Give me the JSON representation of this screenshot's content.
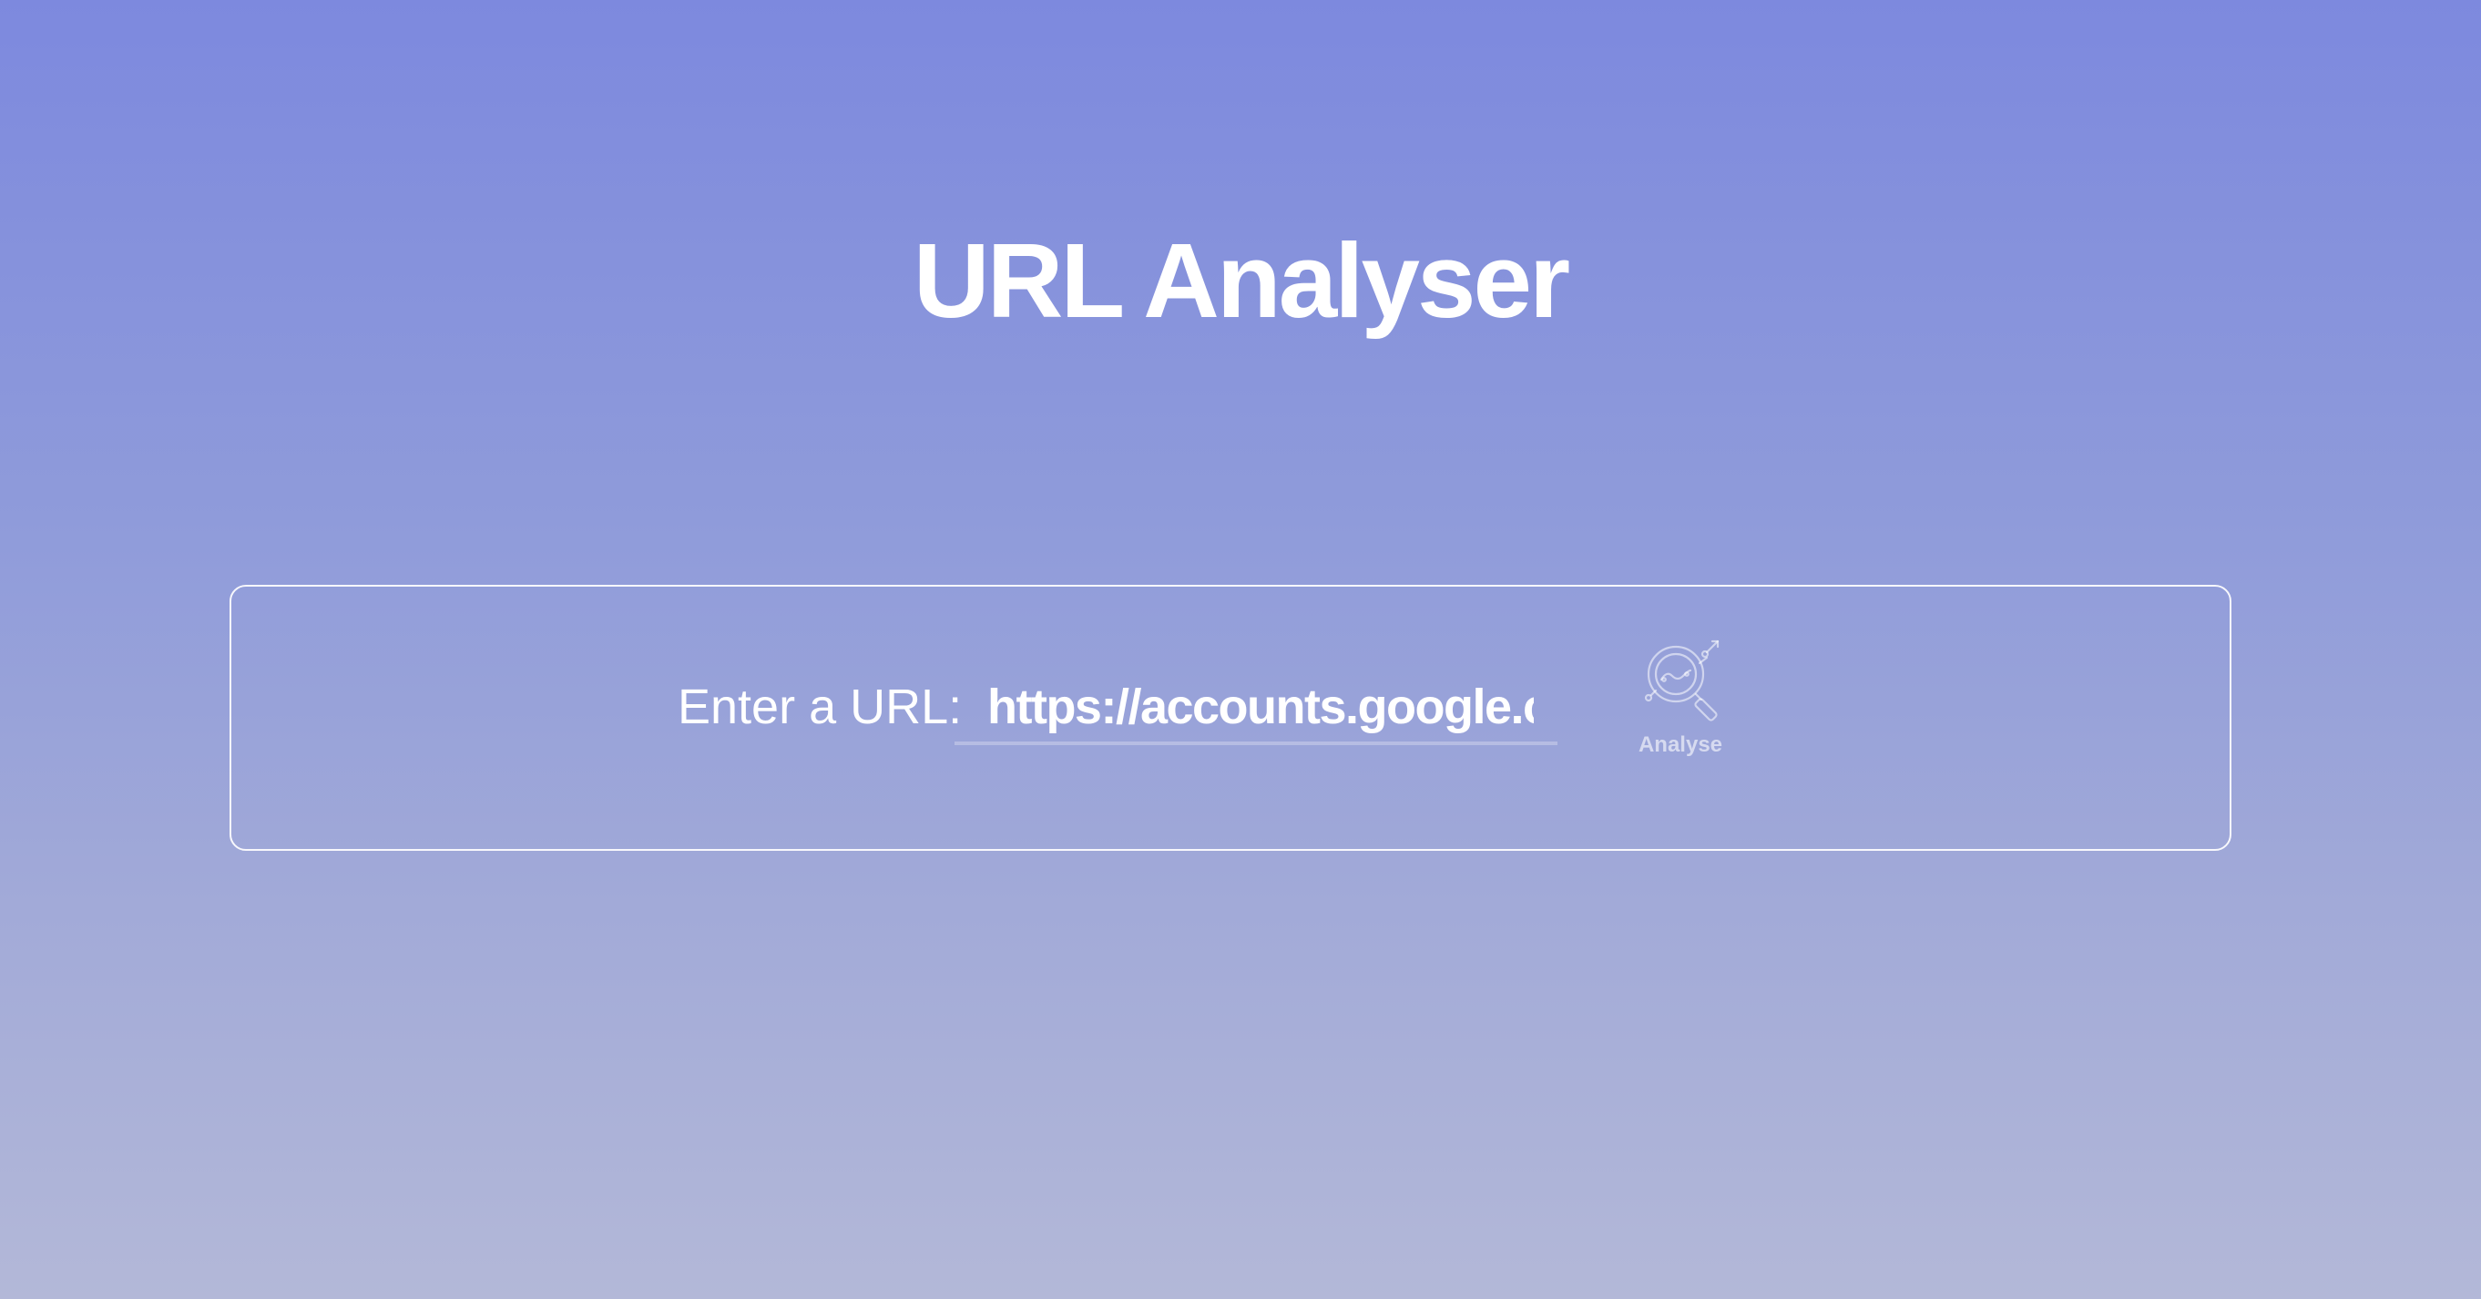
{
  "app": {
    "title": "URL Analyser"
  },
  "form": {
    "label": "Enter a URL:",
    "url_value": "https://accounts.google.com",
    "analyse_label": "Analyse",
    "analyse_icon": "analyse-magnifier-icon"
  },
  "colors": {
    "background_top": "#7d89de",
    "background_bottom": "#b3b8d8",
    "text": "#ffffff"
  }
}
